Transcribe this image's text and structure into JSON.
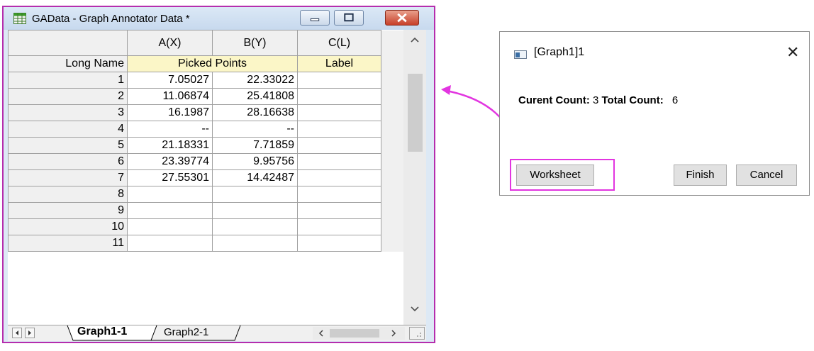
{
  "worksheet": {
    "title": "GAData - Graph Annotator Data *",
    "columns": [
      "A(X)",
      "B(Y)",
      "C(L)"
    ],
    "long_name_label": "Long Name",
    "long_names": {
      "ab": "Picked Points",
      "c": "Label"
    },
    "rows": [
      {
        "n": "1",
        "a": "7.05027",
        "b": "22.33022"
      },
      {
        "n": "2",
        "a": "11.06874",
        "b": "25.41808"
      },
      {
        "n": "3",
        "a": "16.1987",
        "b": "28.16638"
      },
      {
        "n": "4",
        "a": "--",
        "b": "--"
      },
      {
        "n": "5",
        "a": "21.18331",
        "b": "7.71859"
      },
      {
        "n": "6",
        "a": "23.39774",
        "b": "9.95756"
      },
      {
        "n": "7",
        "a": "27.55301",
        "b": "14.42487"
      },
      {
        "n": "8",
        "a": "",
        "b": ""
      },
      {
        "n": "9",
        "a": "",
        "b": ""
      },
      {
        "n": "10",
        "a": "",
        "b": ""
      },
      {
        "n": "11",
        "a": "",
        "b": ""
      }
    ],
    "sheet_tabs": [
      "Graph1-1",
      "Graph2-1"
    ],
    "active_tab": "Graph1-1"
  },
  "dialog": {
    "title": "[Graph1]1",
    "close_glyph": "✕",
    "current_count_label": "Curent Count:",
    "current_count": "3",
    "total_count_label": "Total Count:",
    "total_count": "6",
    "buttons": {
      "worksheet": "Worksheet",
      "finish": "Finish",
      "cancel": "Cancel"
    }
  },
  "colors": {
    "highlight": "#e235e0",
    "window_border": "#b52dad",
    "long_name_bg": "#fbf6c7"
  },
  "icons": [
    "worksheet-app-icon",
    "minimize-icon",
    "maximize-icon",
    "close-icon",
    "scroll-up-icon",
    "scroll-down-icon",
    "dialog-graph-icon",
    "callout-arrow"
  ]
}
